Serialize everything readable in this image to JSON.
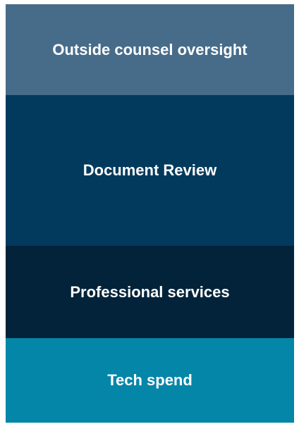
{
  "blocks": [
    {
      "label": "Outside counsel oversight",
      "color": "#476c8a"
    },
    {
      "label": "Document Review",
      "color": "#023a5e"
    },
    {
      "label": "Professional services",
      "color": "#03233a"
    },
    {
      "label": "Tech spend",
      "color": "#0486a8"
    }
  ]
}
